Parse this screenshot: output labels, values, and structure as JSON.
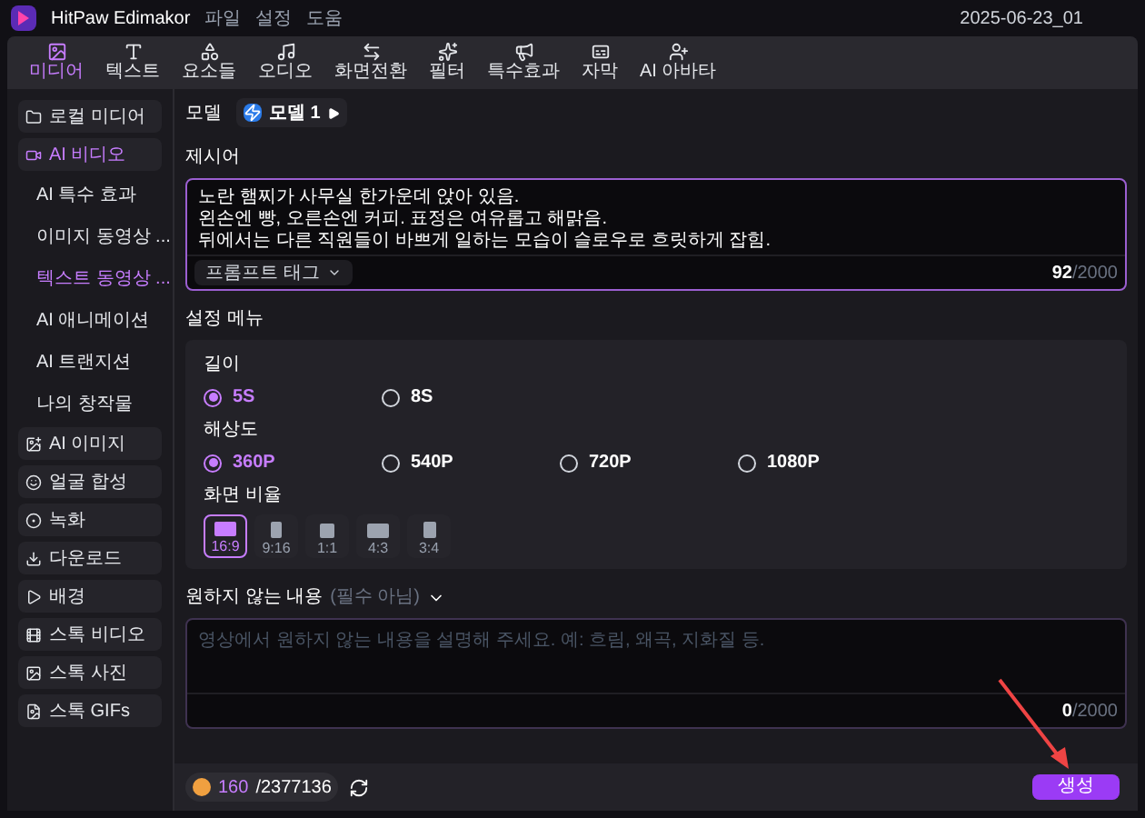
{
  "app": {
    "name": "HitPaw Edimakor",
    "menu": [
      "파일",
      "설정",
      "도움"
    ],
    "project": "2025-06-23_01"
  },
  "toolbar": [
    {
      "label": "미디어",
      "selected": true
    },
    {
      "label": "텍스트",
      "selected": false
    },
    {
      "label": "요소들",
      "selected": false
    },
    {
      "label": "오디오",
      "selected": false
    },
    {
      "label": "화면전환",
      "selected": false
    },
    {
      "label": "필터",
      "selected": false
    },
    {
      "label": "특수효과",
      "selected": false
    },
    {
      "label": "자막",
      "selected": false
    },
    {
      "label": "AI 아바타",
      "selected": false
    }
  ],
  "sidebar": [
    {
      "label": "로컬 미디어",
      "selected": false
    },
    {
      "label": "AI 비디오",
      "selected": true,
      "children": [
        {
          "label": "AI 특수 효과",
          "selected": false
        },
        {
          "label": "이미지 동영상 ...",
          "selected": false
        },
        {
          "label": "텍스트 동영상 ...",
          "selected": true
        },
        {
          "label": "AI 애니메이션",
          "selected": false
        },
        {
          "label": "AI 트랜지션",
          "selected": false
        },
        {
          "label": "나의 창작물",
          "selected": false
        }
      ]
    },
    {
      "label": "AI 이미지",
      "selected": false
    },
    {
      "label": "얼굴 합성",
      "selected": false
    },
    {
      "label": "녹화",
      "selected": false
    },
    {
      "label": "다운로드",
      "selected": false
    },
    {
      "label": "배경",
      "selected": false
    },
    {
      "label": "스톡 비디오",
      "selected": false
    },
    {
      "label": "스톡 사진",
      "selected": false
    },
    {
      "label": "스톡 GIFs",
      "selected": false
    }
  ],
  "model": {
    "label": "모델",
    "value": "모델 1"
  },
  "prompt": {
    "label": "제시어",
    "value": "노란 햄찌가 사무실 한가운데 앉아 있음.\n왼손엔 빵, 오른손엔  커피. 표정은 여유롭고 해맑음.\n뒤에서는 다른 직원들이 바쁘게 일하는 모습이 슬로우로 흐릿하게 잡힘.",
    "tag_button": "프롬프트 태그",
    "count": "92",
    "max": "/2000"
  },
  "settings": {
    "title": "설정 메뉴",
    "groups": [
      {
        "label": "길이",
        "kind": "radio",
        "options": [
          {
            "label": "5S",
            "selected": true
          },
          {
            "label": "8S",
            "selected": false
          }
        ]
      },
      {
        "label": "해상도",
        "kind": "radio",
        "options": [
          {
            "label": "360P",
            "selected": true
          },
          {
            "label": "540P",
            "selected": false
          },
          {
            "label": "720P",
            "selected": false
          },
          {
            "label": "1080P",
            "selected": false
          }
        ]
      },
      {
        "label": "화면 비율",
        "kind": "ratio",
        "options": [
          {
            "label": "16:9",
            "selected": true
          },
          {
            "label": "9:16",
            "selected": false
          },
          {
            "label": "1:1",
            "selected": false
          },
          {
            "label": "4:3",
            "selected": false
          },
          {
            "label": "3:4",
            "selected": false
          }
        ]
      }
    ]
  },
  "negative": {
    "label": "원하지 않는 내용",
    "hint": "(필수 아님)",
    "placeholder": "영상에서 원하지 않는 내용을 설명해 주세요. 예: 흐림, 왜곡, 지화질 등.",
    "count": "0",
    "max": "/2000"
  },
  "footer": {
    "credits_used": "160",
    "credits_total": "/2377136",
    "generate": "생성"
  }
}
